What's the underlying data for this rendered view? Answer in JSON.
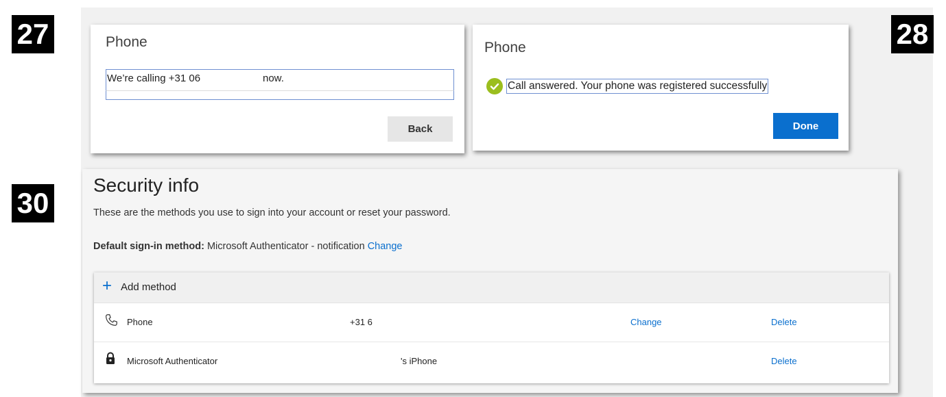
{
  "steps": {
    "a": "27",
    "b": "28",
    "c": "30"
  },
  "card_call": {
    "title": "Phone",
    "status_text": "We’re calling +31 06 ",
    "status_suffix": "now.",
    "back_label": "Back"
  },
  "card_done": {
    "title": "Phone",
    "message": "Call answered. Your phone was registered successfully",
    "done_label": "Done"
  },
  "security": {
    "title": "Security info",
    "description": "These are the methods you use to sign into your account or reset your password.",
    "default_label": "Default sign-in method:",
    "default_value": "Microsoft Authenticator - notification",
    "default_change": "Change",
    "add_method": "Add method",
    "methods": [
      {
        "icon": "phone-icon",
        "name": "Phone",
        "value": "+31 6",
        "change": "Change",
        "delete": "Delete"
      },
      {
        "icon": "lock-icon",
        "name": "Microsoft Authenticator",
        "value": "'s iPhone",
        "change": "",
        "delete": "Delete"
      }
    ]
  },
  "colors": {
    "accent": "#0a6fce",
    "success": "#9bbe1e"
  }
}
